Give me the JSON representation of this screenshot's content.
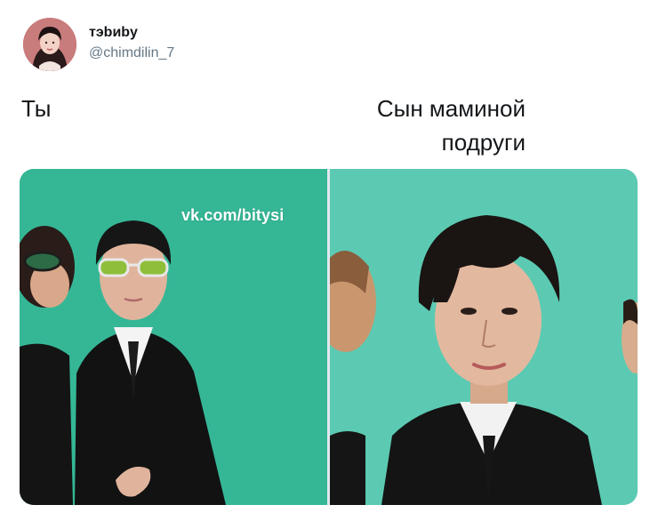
{
  "tweet": {
    "author": {
      "display_name": "тэbиby",
      "handle": "@chimdilin_7",
      "avatar_icon": "profile-photo"
    },
    "captions": {
      "left": "Ты",
      "right": "Сын маминой\nподруги"
    },
    "media": {
      "left_photo": {
        "watermark": "vk.com/bitysi"
      },
      "right_photo": {}
    }
  },
  "colors": {
    "text_primary": "#14171a",
    "text_secondary": "#657786",
    "photo_background_left": "#38b898",
    "photo_background_right": "#5dcbb3"
  }
}
